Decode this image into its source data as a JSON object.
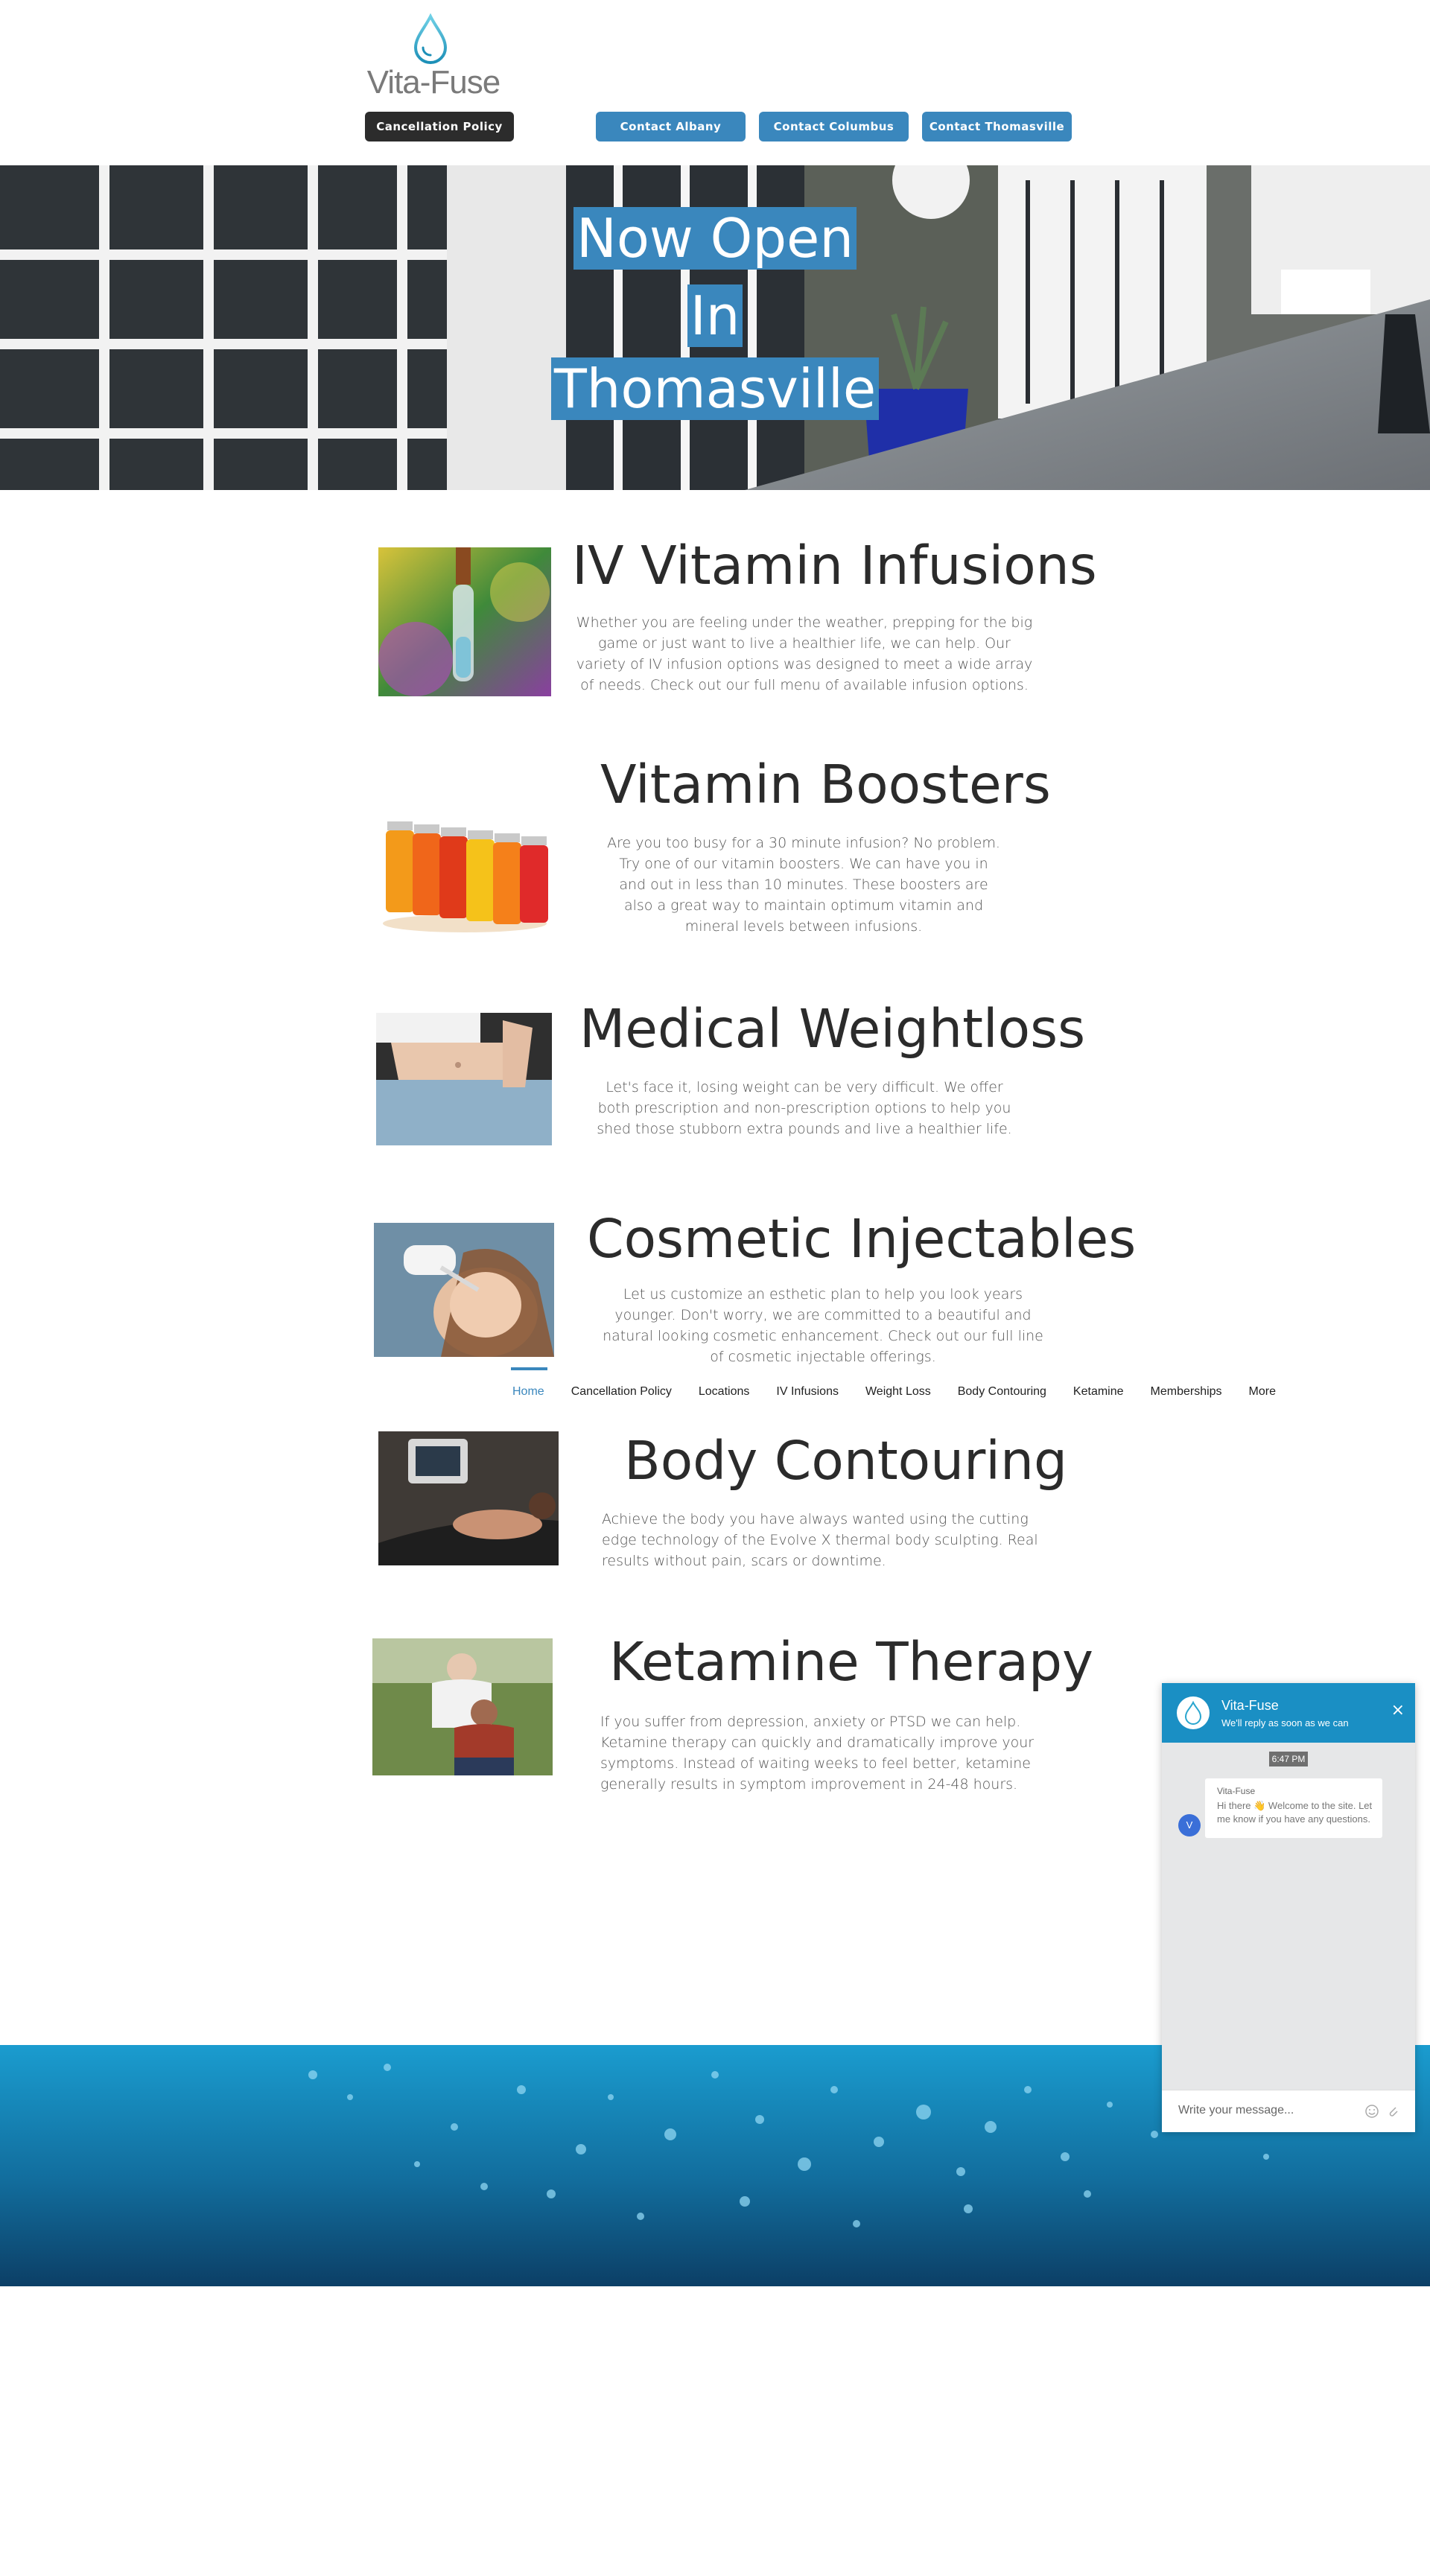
{
  "header": {
    "logo_text": "Vita-Fuse",
    "buttons": {
      "cancellation": "Cancellation Policy",
      "albany": "Contact Albany",
      "columbus": "Contact Columbus",
      "thomasville": "Contact Thomasville"
    }
  },
  "hero": {
    "line1": "Now Open",
    "line2": "In",
    "line3": "Thomasville"
  },
  "services": [
    {
      "title": "IV Vitamin Infusions",
      "description": "Whether you are feeling under the weather, prepping for the big game or just want to live a healthier life, we can help.  Our variety of IV infusion options was designed to meet a wide array of needs.  Check out our full menu of available infusion options."
    },
    {
      "title": "Vitamin Boosters",
      "description": "Are you too busy for a 30 minute infusion? No problem. Try one of our vitamin boosters.  We can have you in and out in less than 10 minutes.  These boosters are also a great way to maintain optimum vitamin and mineral levels between infusions."
    },
    {
      "title": "Medical Weightloss",
      "description": "Let's face it, losing weight can be very difficult.  We offer both prescription and non-prescription options to help you shed those stubborn extra pounds and live a healthier life."
    },
    {
      "title": "Cosmetic Injectables",
      "description": "Let us customize an esthetic plan to help you look years younger. Don't worry, we are committed to a beautiful and natural looking cosmetic enhancement. Check out our full line of cosmetic injectable offerings."
    },
    {
      "title": "Body Contouring",
      "description": "Achieve the body you have always wanted using the cutting edge technology of the Evolve X thermal body sculpting.  Real results without pain, scars or downtime."
    },
    {
      "title": "Ketamine Therapy",
      "description": "If you suffer from depression, anxiety or PTSD we can help.  Ketamine therapy can quickly and dramatically improve your symptoms.  Instead of waiting weeks to feel better, ketamine generally results in symptom improvement in 24-48 hours."
    }
  ],
  "nav": {
    "items": [
      "Home",
      "Cancellation Policy",
      "Locations",
      "IV Infusions",
      "Weight Loss",
      "Body Contouring",
      "Ketamine",
      "Memberships",
      "More"
    ],
    "active": "Home"
  },
  "chat": {
    "name": "Vita-Fuse",
    "subtitle": "We'll reply as soon as we can",
    "time": "6:47 PM",
    "sender": "Vita-Fuse",
    "message": "Hi there 👋 Welcome to the site. Let me know if you have any questions.",
    "avatar_letter": "V",
    "placeholder": "Write your message...",
    "close_symbol": "×",
    "accent_color": "#1a8fc4"
  },
  "colors": {
    "brand_blue": "#3a87bd",
    "dark_button": "#2c2c2c"
  }
}
